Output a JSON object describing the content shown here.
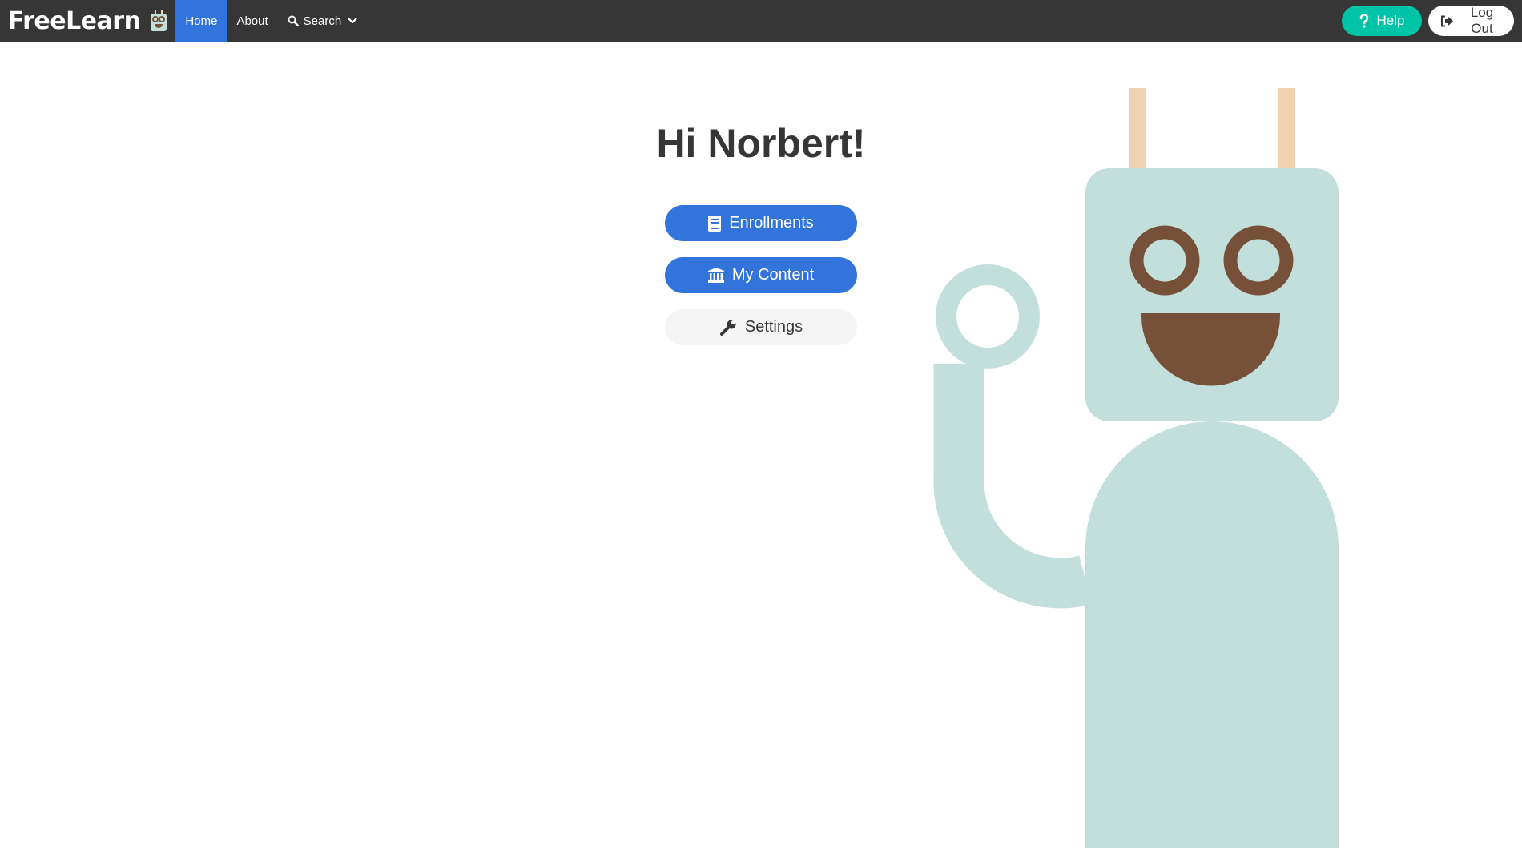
{
  "nav": {
    "brand": "FreeLearn",
    "items": [
      {
        "label": "Home",
        "active": true
      },
      {
        "label": "About",
        "active": false
      }
    ],
    "search_label": "Search",
    "help_label": "Help",
    "logout_label": "Log Out"
  },
  "main": {
    "greeting": "Hi Norbert!",
    "buttons": {
      "enrollments": "Enrollments",
      "my_content": "My Content",
      "settings": "Settings"
    }
  },
  "icons": {
    "brand": "robot-logo-icon",
    "search": "search-icon",
    "dropdown": "chevron-down-icon",
    "help": "question-icon",
    "logout": "sign-out-icon",
    "enrollments": "book-icon",
    "my_content": "university-icon",
    "settings": "wrench-icon"
  },
  "colors": {
    "navbar": "#363636",
    "primary": "#3273dc",
    "help": "#00c4a7",
    "robot_body": "#c3dfdb",
    "robot_features": "#77503a",
    "robot_antenna": "#f0d2b0"
  }
}
